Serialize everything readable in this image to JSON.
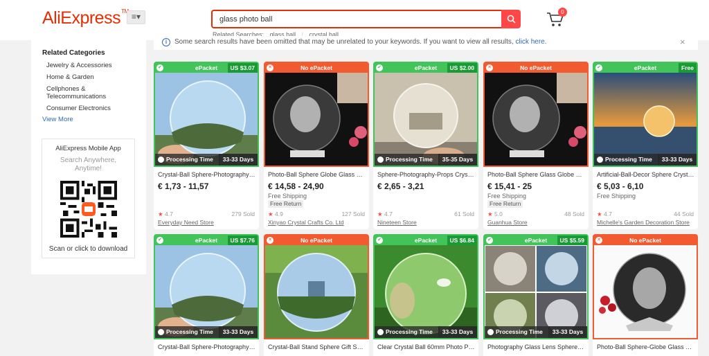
{
  "header": {
    "logo": "AliExpress",
    "logo_tm": "TM",
    "menu_glyph": "≡▾",
    "search": {
      "value": "glass photo ball",
      "button_icon": "search-icon"
    },
    "related_label": "Related Searches:",
    "related": [
      "glass ball",
      "crystal ball"
    ],
    "cart_count": "0"
  },
  "sidebar": {
    "title": "Related Categories",
    "categories": [
      "Jewelry & Accessories",
      "Home & Garden",
      "Cellphones & Telecommunications",
      "Consumer Electronics"
    ],
    "view_more": "View More",
    "app": {
      "title": "AliExpress Mobile App",
      "subtitle_line1": "Search Anywhere,",
      "subtitle_line2": "Anytime!",
      "scan": "Scan or click to download"
    }
  },
  "notice": {
    "text": "Some search results have been omitted that may be unrelated to your keywords. If you want to view all results,",
    "link": "click here.",
    "close": "×"
  },
  "colors": {
    "brand": "#e62e04",
    "epacket": "#43c45a",
    "no_epacket": "#f25a30",
    "link": "#2e6ab4"
  },
  "products": [
    {
      "badge": "ePacket",
      "badge_price": "US $3.07",
      "proc_label": "Processing Time",
      "proc_days": "33-33 Days",
      "title": "Crystal-Ball Sphere-Photography-P...",
      "price": "€ 1,73 - 11,57",
      "shipping": "",
      "free_return": "",
      "rating": "4.7",
      "sold": "279 Sold",
      "store": "Everyday Need Store"
    },
    {
      "badge": "No ePacket",
      "badge_price": "",
      "proc_label": "",
      "proc_days": "",
      "title": "Photo-Ball Sphere Globe Glass Eng...",
      "price": "€ 14,58 - 24,90",
      "shipping": "Free Shipping",
      "free_return": "Free Return",
      "rating": "4.9",
      "sold": "127 Sold",
      "store": "Xinyao Crystal Crafts Co. Ltd"
    },
    {
      "badge": "ePacket",
      "badge_price": "US $2.00",
      "proc_label": "Processing Time",
      "proc_days": "35-35 Days",
      "title": "Sphere-Photography-Props Crystal...",
      "price": "€ 2,65 - 3,21",
      "shipping": "",
      "free_return": "",
      "rating": "4.7",
      "sold": "61 Sold",
      "store": "Nineteen Store"
    },
    {
      "badge": "No ePacket",
      "badge_price": "",
      "proc_label": "",
      "proc_days": "",
      "title": "Photo-Ball Sphere Glass Globe Cry...",
      "price": "€ 15,41 - 25",
      "shipping": "Free Shipping",
      "free_return": "Free Return",
      "rating": "5.0",
      "sold": "48 Sold",
      "store": "Guanhua Store"
    },
    {
      "badge": "ePacket",
      "badge_price": "Free",
      "proc_label": "Processing Time",
      "proc_days": "33-33 Days",
      "title": "Artificial-Ball-Decor Sphere Crystal...",
      "price": "€ 5,03 - 6,10",
      "shipping": "Free Shipping",
      "free_return": "",
      "rating": "4.7",
      "sold": "44 Sold",
      "store": "Michelle's Garden Decoration Store"
    },
    {
      "badge": "ePacket",
      "badge_price": "US $7.76",
      "proc_label": "Processing Time",
      "proc_days": "33-33 Days",
      "title": "Crystal-Ball Sphere-Photography-P...",
      "price": "",
      "shipping": "",
      "free_return": "",
      "rating": "",
      "sold": "",
      "store": ""
    },
    {
      "badge": "No ePacket",
      "badge_price": "",
      "proc_label": "",
      "proc_days": "",
      "title": "Crystal-Ball Stand Sphere Gift Sho...",
      "price": "",
      "shipping": "",
      "free_return": "",
      "rating": "",
      "sold": "",
      "store": ""
    },
    {
      "badge": "ePacket",
      "badge_price": "US $6.84",
      "proc_label": "Processing Time",
      "proc_days": "33-33 Days",
      "title": "Clear Crystal Ball 60mm Photo Pho...",
      "price": "",
      "shipping": "",
      "free_return": "",
      "rating": "",
      "sold": "",
      "store": ""
    },
    {
      "badge": "ePacket",
      "badge_price": "US $5.59",
      "proc_label": "Processing Time",
      "proc_days": "33-33 Days",
      "title": "Photography Glass Lens Sphere-B...",
      "price": "",
      "shipping": "",
      "free_return": "",
      "rating": "",
      "sold": "",
      "store": ""
    },
    {
      "badge": "No ePacket",
      "badge_price": "",
      "proc_label": "",
      "proc_days": "",
      "title": "Photo-Ball Sphere-Globe Glass Cry...",
      "price": "",
      "shipping": "",
      "free_return": "",
      "rating": "",
      "sold": "",
      "store": ""
    }
  ]
}
